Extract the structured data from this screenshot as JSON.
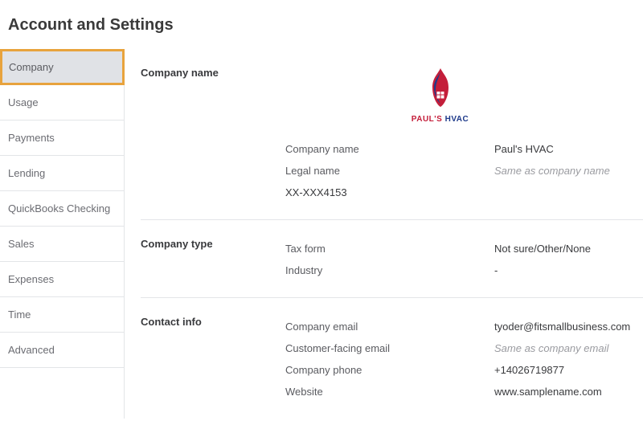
{
  "page_title": "Account and Settings",
  "sidebar": {
    "items": [
      {
        "label": "Company",
        "active": true
      },
      {
        "label": "Usage",
        "active": false
      },
      {
        "label": "Payments",
        "active": false
      },
      {
        "label": "Lending",
        "active": false
      },
      {
        "label": "QuickBooks Checking",
        "active": false
      },
      {
        "label": "Sales",
        "active": false
      },
      {
        "label": "Expenses",
        "active": false
      },
      {
        "label": "Time",
        "active": false
      },
      {
        "label": "Advanced",
        "active": false
      }
    ]
  },
  "company_name_section": {
    "heading": "Company name",
    "logo_text_primary": "PAUL'S",
    "logo_text_secondary": "HVAC",
    "fields": {
      "company_name_label": "Company name",
      "company_name_value": "Paul's HVAC",
      "legal_name_label": "Legal name",
      "legal_name_value": "Same as company name",
      "extra_line": "XX-XXX4153"
    }
  },
  "company_type_section": {
    "heading": "Company type",
    "fields": {
      "tax_form_label": "Tax form",
      "tax_form_value": "Not sure/Other/None",
      "industry_label": "Industry",
      "industry_value": "-"
    }
  },
  "contact_info_section": {
    "heading": "Contact info",
    "fields": {
      "company_email_label": "Company email",
      "company_email_value": "tyoder@fitsmallbusiness.com",
      "customer_email_label": "Customer-facing email",
      "customer_email_value": "Same as company email",
      "company_phone_label": "Company phone",
      "company_phone_value": "+14026719877",
      "website_label": "Website",
      "website_value": "www.samplename.com"
    }
  }
}
